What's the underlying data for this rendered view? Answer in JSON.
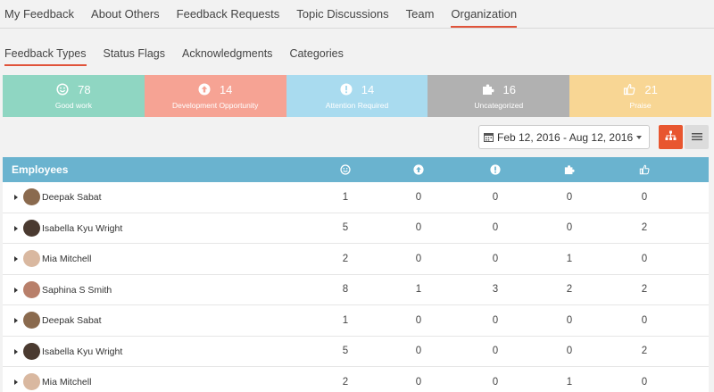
{
  "top_tabs": [
    "My Feedback",
    "About Others",
    "Feedback Requests",
    "Topic Discussions",
    "Team",
    "Organization"
  ],
  "sub_tabs": [
    "Feedback Types",
    "Status Flags",
    "Acknowledgments",
    "Categories"
  ],
  "cards": [
    {
      "count": "78",
      "label": "Good work",
      "icon": "smile-icon",
      "color": "#8fd6c2"
    },
    {
      "count": "14",
      "label": "Development Opportunity",
      "icon": "arrow-up-circle-icon",
      "color": "#f6a394"
    },
    {
      "count": "14",
      "label": "Attention Required",
      "icon": "exclamation-circle-icon",
      "color": "#a9dbef"
    },
    {
      "count": "16",
      "label": "Uncategorized",
      "icon": "puzzle-icon",
      "color": "#b1b1b1"
    },
    {
      "count": "21",
      "label": "Praise",
      "icon": "thumbs-up-icon",
      "color": "#f8d694"
    }
  ],
  "date_range": "Feb 12, 2016 - Aug 12, 2016",
  "table": {
    "header": "Employees",
    "rows": [
      {
        "name": "Deepak Sabat",
        "values": [
          "1",
          "0",
          "0",
          "0",
          "0"
        ]
      },
      {
        "name": "Isabella Kyu Wright",
        "values": [
          "5",
          "0",
          "0",
          "0",
          "2"
        ]
      },
      {
        "name": "Mia Mitchell",
        "values": [
          "2",
          "0",
          "0",
          "1",
          "0"
        ]
      },
      {
        "name": "Saphina S Smith",
        "values": [
          "8",
          "1",
          "3",
          "2",
          "2"
        ]
      },
      {
        "name": "Deepak Sabat",
        "values": [
          "1",
          "0",
          "0",
          "0",
          "0"
        ]
      },
      {
        "name": "Isabella Kyu Wright",
        "values": [
          "5",
          "0",
          "0",
          "0",
          "2"
        ]
      },
      {
        "name": "Mia Mitchell",
        "values": [
          "2",
          "0",
          "0",
          "1",
          "0"
        ]
      }
    ]
  }
}
